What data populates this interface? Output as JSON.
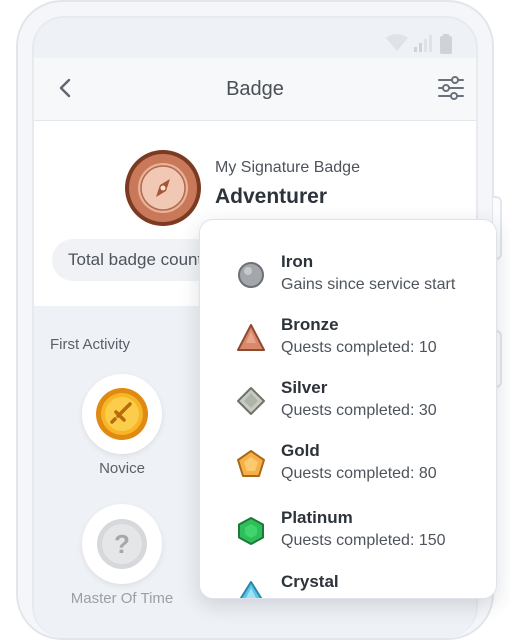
{
  "header": {
    "title": "Badge",
    "back_icon": "chevron-left-icon",
    "filter_icon": "sliders-icon"
  },
  "signature": {
    "label": "My Signature Badge",
    "name": "Adventurer",
    "total_label": "Total badge count"
  },
  "activity": {
    "section_title": "First Activity",
    "badges": [
      {
        "label": "Novice",
        "icon": "sword-coin-icon"
      },
      {
        "label": "Master Of Time",
        "icon": "question-icon"
      }
    ]
  },
  "tiers": [
    {
      "name": "Iron",
      "desc": "Gains since service start",
      "icon": "iron-circle-icon",
      "color": "#a3a6aa"
    },
    {
      "name": "Bronze",
      "desc": "Quests completed: 10",
      "icon": "bronze-triangle-icon",
      "color": "#d9886a"
    },
    {
      "name": "Silver",
      "desc": "Quests completed: 30",
      "icon": "silver-diamond-icon",
      "color": "#b9bfb4"
    },
    {
      "name": "Gold",
      "desc": "Quests completed: 80",
      "icon": "gold-pentagon-icon",
      "color": "#f6b04a"
    },
    {
      "name": "Platinum",
      "desc": "Quests completed: 150",
      "icon": "platinum-hexagon-icon",
      "color": "#2fbf5a"
    },
    {
      "name": "Crystal",
      "desc": "",
      "icon": "crystal-drop-icon",
      "color": "#5cc6e8"
    }
  ]
}
